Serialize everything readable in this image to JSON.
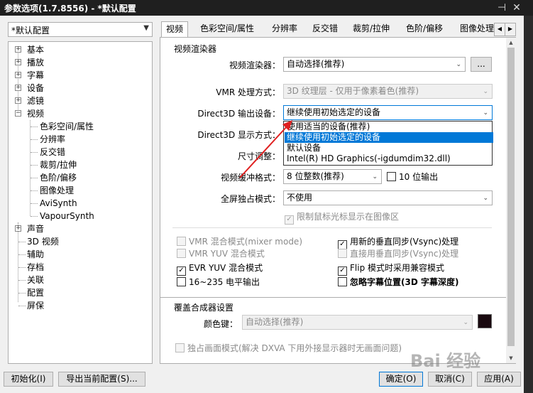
{
  "window": {
    "title": "参数选项(1.7.8556) - *默认配置"
  },
  "profile": {
    "selected": "*默认配置"
  },
  "tree": {
    "items": [
      {
        "label": "基本",
        "expandable": true
      },
      {
        "label": "播放",
        "expandable": true
      },
      {
        "label": "字幕",
        "expandable": true
      },
      {
        "label": "设备",
        "expandable": true
      },
      {
        "label": "滤镜",
        "expandable": true
      },
      {
        "label": "视频",
        "expandable": true,
        "expanded": true
      },
      {
        "label": "色彩空间/属性",
        "child": true
      },
      {
        "label": "分辨率",
        "child": true
      },
      {
        "label": "反交错",
        "child": true
      },
      {
        "label": "裁剪/拉伸",
        "child": true
      },
      {
        "label": "色阶/偏移",
        "child": true
      },
      {
        "label": "图像处理",
        "child": true
      },
      {
        "label": "AviSynth",
        "child": true
      },
      {
        "label": "VapourSynth",
        "child": true
      },
      {
        "label": "声音",
        "expandable": true
      },
      {
        "label": "3D 视频"
      },
      {
        "label": "辅助"
      },
      {
        "label": "存档"
      },
      {
        "label": "关联"
      },
      {
        "label": "配置"
      },
      {
        "label": "屏保"
      }
    ]
  },
  "tabs": [
    "视频",
    "色彩空间/属性",
    "分辨率",
    "反交错",
    "裁剪/拉伸",
    "色阶/偏移",
    "图像处理"
  ],
  "video": {
    "renderer_group": "视频渲染器",
    "renderer_label": "视频渲染器：",
    "renderer_value": "自动选择(推荐)",
    "renderer_more": "...",
    "vmr_label": "VMR 处理方式：",
    "vmr_value": "3D 纹理层 - 仅用于像素着色(推荐)",
    "d3d_out_label": "Direct3D 输出设备：",
    "d3d_out_value": "继续使用初始选定的设备",
    "d3d_disp_label": "Direct3D 显示方式：",
    "size_label": "尺寸调整：",
    "buffer_label": "视频缓冲格式：",
    "buffer_value": "8 位整数(推荐)",
    "tenbit_label": "10 位输出",
    "fullscreen_label": "全屏独占模式：",
    "fullscreen_value": "不使用",
    "limit_cursor_label": "限制鼠标光标显示在图像区",
    "dropdown_options": [
      "使用适当的设备(推荐)",
      "继续使用初始选定的设备",
      "默认设备",
      "Intel(R) HD Graphics(-igdumdim32.dll)"
    ],
    "checks": {
      "vmr_mix": "VMR 混合模式(mixer mode)",
      "vmr_yuv": "VMR YUV 混合模式",
      "evr_yuv": "EVR YUV 混合模式",
      "level_16_235": "16~235 电平输出",
      "new_vsync": "用新的垂直同步(Vsync)处理",
      "direct_vsync": "直接用垂直同步(Vsync)处理",
      "flip_mode": "Flip 模式时采用兼容模式",
      "ignore_sub": "忽略字幕位置(3D 字幕深度)"
    },
    "overlay_group": "覆盖合成器设置",
    "color_key_label": "颜色键：",
    "color_key_value": "自动选择(推荐)",
    "exclusive_label": "独占画面模式(解决 DXVA 下用外接显示器时无画面问题)"
  },
  "footer": {
    "init": "初始化(I)",
    "export": "导出当前配置(S)...",
    "ok": "确定(O)",
    "cancel": "取消(C)",
    "apply": "应用(A)"
  },
  "watermark": "Bai 经验",
  "colors": {
    "accent": "#0078d7",
    "color_key": "#1a0a10"
  }
}
